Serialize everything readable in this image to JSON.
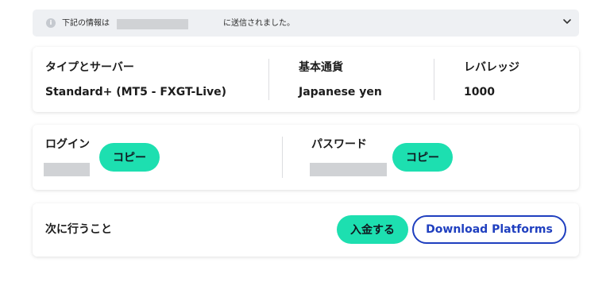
{
  "notice": {
    "text_before": "下記の情報は",
    "text_after": "に送信されました。",
    "info_icon": "info-icon",
    "toggle_icon": "chevron-down-icon"
  },
  "account": {
    "type_label": "タイプとサーバー",
    "type_value": "Standard+ (MT5 - FXGT-Live)",
    "currency_label": "基本通貨",
    "currency_value": "Japanese yen",
    "leverage_label": "レバレッジ",
    "leverage_value": "1000"
  },
  "credentials": {
    "login_label": "ログイン",
    "login_copy": "コピー",
    "password_label": "パスワード",
    "password_copy": "コピー"
  },
  "next": {
    "label": "次に行うこと",
    "deposit": "入金する",
    "download": "Download Platforms"
  },
  "colors": {
    "accent_teal": "#1ddfb0",
    "link_blue": "#1f3fbf",
    "banner_bg": "#eef0f3"
  }
}
